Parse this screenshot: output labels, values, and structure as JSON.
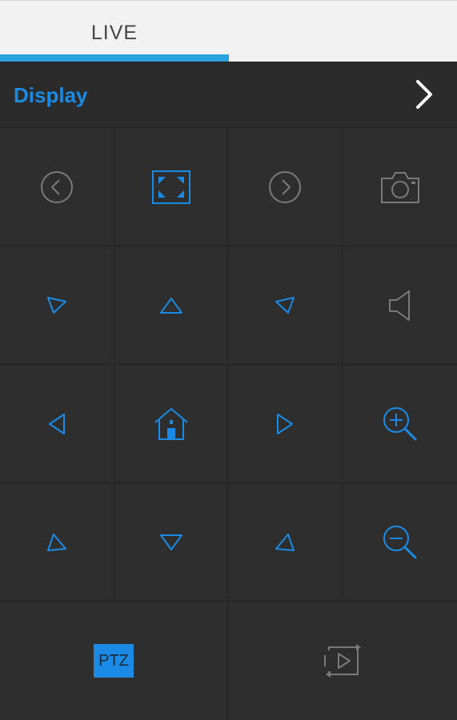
{
  "tabs": [
    {
      "label": "LIVE",
      "active": true
    }
  ],
  "header": {
    "title": "Display"
  },
  "colors": {
    "accent": "#1a8ae4",
    "tab_indicator": "#2ba2dc",
    "inactive_icon": "#7a7a7a"
  },
  "controls": {
    "row1": [
      "previous-channel-icon",
      "fullscreen-icon",
      "next-channel-icon",
      "snapshot-camera-icon"
    ],
    "row2": [
      "pan-up-left-icon",
      "pan-up-icon",
      "pan-up-right-icon",
      "audio-speaker-icon"
    ],
    "row3": [
      "pan-left-icon",
      "home-preset-icon",
      "pan-right-icon",
      "zoom-in-icon"
    ],
    "row4": [
      "pan-down-left-icon",
      "pan-down-icon",
      "pan-down-right-icon",
      "zoom-out-icon"
    ]
  },
  "bottom": {
    "ptz_label": "PTZ",
    "playback_icon": "playback-switch-icon"
  }
}
